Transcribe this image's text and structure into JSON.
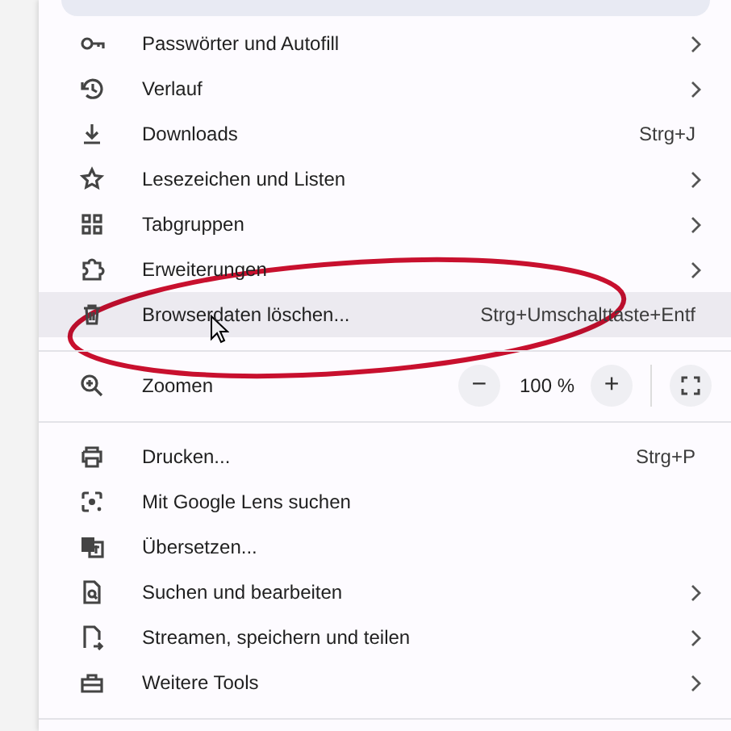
{
  "menu": {
    "rows": [
      {
        "kind": "item",
        "label": "Passwörter und Autofill",
        "submenu": true,
        "highlighted": false
      },
      {
        "kind": "item",
        "label": "Verlauf",
        "submenu": true,
        "highlighted": false
      },
      {
        "kind": "item",
        "label": "Downloads",
        "shortcut": "Strg+J",
        "submenu": false,
        "highlighted": false
      },
      {
        "kind": "item",
        "label": "Lesezeichen und Listen",
        "submenu": true,
        "highlighted": false
      },
      {
        "kind": "item",
        "label": "Tabgruppen",
        "submenu": true,
        "highlighted": false
      },
      {
        "kind": "item",
        "label": "Erweiterungen",
        "submenu": true,
        "highlighted": false
      },
      {
        "kind": "item",
        "label": "Browserdaten löschen...",
        "shortcut": "Strg+Umschalttaste+Entf",
        "submenu": false,
        "highlighted": true
      },
      {
        "kind": "divider"
      },
      {
        "kind": "zoom",
        "label": "Zoomen",
        "minus": "−",
        "value": "100 %",
        "plus": "+"
      },
      {
        "kind": "divider"
      },
      {
        "kind": "item",
        "label": "Drucken...",
        "shortcut": "Strg+P",
        "submenu": false,
        "highlighted": false
      },
      {
        "kind": "item",
        "label": "Mit Google Lens suchen",
        "submenu": false,
        "highlighted": false
      },
      {
        "kind": "item",
        "label": "Übersetzen...",
        "submenu": false,
        "highlighted": false
      },
      {
        "kind": "item",
        "label": "Suchen und bearbeiten",
        "submenu": true,
        "highlighted": false
      },
      {
        "kind": "item",
        "label": "Streamen, speichern und teilen",
        "submenu": true,
        "highlighted": false
      },
      {
        "kind": "item",
        "label": "Weitere Tools",
        "submenu": true,
        "highlighted": false
      },
      {
        "kind": "divider"
      }
    ]
  }
}
